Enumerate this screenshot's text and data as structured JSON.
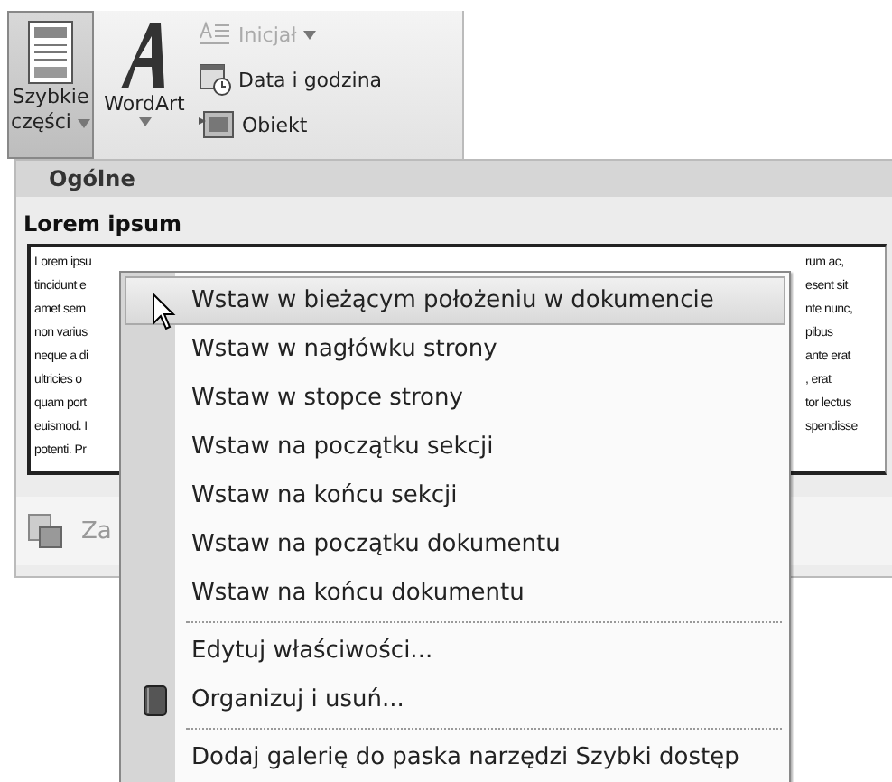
{
  "ribbon": {
    "large_buttons": [
      {
        "kind": "parts",
        "label_lines": [
          "Szybkie",
          "części"
        ],
        "pressed": true,
        "dropdown": true
      },
      {
        "kind": "wordart",
        "label_lines": [
          "WordArt"
        ],
        "pressed": false,
        "dropdown": true
      }
    ],
    "small_buttons": [
      {
        "kind": "dropcap",
        "label": "Inicjał",
        "disabled": true,
        "dropdown": true
      },
      {
        "kind": "datetime",
        "label": "Data i godzina",
        "disabled": false,
        "dropdown": false
      },
      {
        "kind": "object",
        "label": "Obiekt",
        "disabled": false,
        "dropdown": false
      }
    ]
  },
  "gallery": {
    "category": "Ogólne",
    "entry_title": "Lorem ipsum",
    "preview_left": [
      "Lorem ipsu",
      "tincidunt e",
      "amet sem",
      "non varius",
      "neque a di",
      "ultricies o",
      "quam port",
      "euismod. I",
      "potenti. Pr"
    ],
    "preview_right": [
      "rum ac,",
      "esent sit",
      "nte nunc,",
      "pibus",
      "ante erat",
      ", erat",
      "tor lectus",
      "spendisse"
    ],
    "footer_text": "Za"
  },
  "context_menu": {
    "items": [
      {
        "kind": "plain",
        "label": "Wstaw w bieżącym położeniu w dokumencie",
        "highlighted": true,
        "separator_before": false
      },
      {
        "kind": "plain",
        "label": "Wstaw w nagłówku strony",
        "highlighted": false,
        "separator_before": false
      },
      {
        "kind": "plain",
        "label": "Wstaw w stopce strony",
        "highlighted": false,
        "separator_before": false
      },
      {
        "kind": "plain",
        "label": "Wstaw na początku sekcji",
        "highlighted": false,
        "separator_before": false
      },
      {
        "kind": "plain",
        "label": "Wstaw na końcu sekcji",
        "highlighted": false,
        "separator_before": false
      },
      {
        "kind": "plain",
        "label": "Wstaw na początku dokumentu",
        "highlighted": false,
        "separator_before": false
      },
      {
        "kind": "plain",
        "label": "Wstaw na końcu dokumentu",
        "highlighted": false,
        "separator_before": false
      },
      {
        "kind": "plain",
        "label": "Edytuj właściwości...",
        "highlighted": false,
        "separator_before": true
      },
      {
        "kind": "book",
        "label": "Organizuj i usuń...",
        "highlighted": false,
        "separator_before": false
      },
      {
        "kind": "plain",
        "label": "Dodaj galerię do paska narzędzi Szybki dostęp",
        "highlighted": false,
        "separator_before": true
      }
    ]
  }
}
